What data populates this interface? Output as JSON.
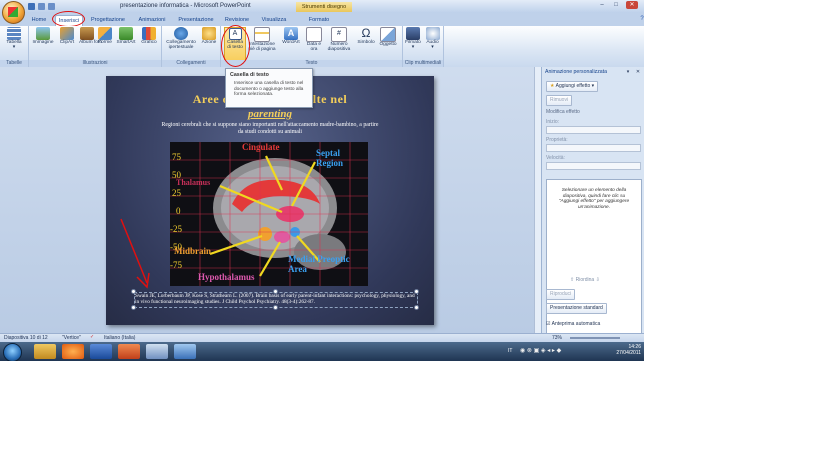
{
  "window": {
    "title": "presentazione informatica - Microsoft PowerPoint",
    "context_tab": "Strumenti disegno",
    "buttons": {
      "min": "–",
      "max": "□",
      "close": "✕"
    }
  },
  "tabs": [
    "Home",
    "Inserisci",
    "Progettazione",
    "Animazioni",
    "Presentazione",
    "Revisione",
    "Visualizza",
    "Formato"
  ],
  "ribbon": {
    "groups": {
      "tabelle": "Tabelle",
      "illustrazioni": "Illustrazioni",
      "collegamenti": "Collegamenti",
      "testo": "Testo",
      "clip": "Clip multimediali"
    },
    "buttons": {
      "tabella": "Tabella",
      "immagine": "Immagine",
      "clipart": "ClipArt",
      "album": "Album foto",
      "forme": "Forme",
      "smartart": "SmartArt",
      "grafico": "Grafico",
      "collegamento": "Collegamento ipertestuale",
      "azione": "Azione",
      "casella": "Casella di testo",
      "intestazione": "Intestazione piè di pagina",
      "wordart": "WordArt",
      "data": "Data e ora",
      "numero": "Numero diapositiva",
      "simbolo": "Simbolo",
      "oggetto": "Oggetto",
      "filmato": "Filmato",
      "audio": "Audio"
    },
    "tooltip": {
      "title": "Casella di testo",
      "desc": "Inserisce una casella di testo nel documento o aggiunge testo alla forma selezionata."
    }
  },
  "slide": {
    "title": "Aree cerebrali coinvolte nel",
    "subtitle": "parenting",
    "body": "Regioni cerebrali che si suppone siano importanti nell'attaccamento madre-bambino, a partire da studi condotti su animali",
    "labels": {
      "cingulate": "Cingulate",
      "thalamus": "Thalamus",
      "septal": "Septal Region",
      "midbrain": "Midbrain",
      "hypothalamus": "Hypothalamus",
      "medial": "Medial Preoptic Area"
    },
    "yticks": [
      "75",
      "50",
      "25",
      "0",
      "-25",
      "-50",
      "-75"
    ],
    "citation": "Swain JE, Lorberbaum JP, Kose S, Strathearn L. (2007). Brain basis of early parent-infant interactions: psychology, physiology, and in vivo functional neuroimaging studies. J Child Psychol Psychiatry. 48(3-4):262-87."
  },
  "pane": {
    "title": "Animazione personalizzata",
    "add_effect": "Aggiungi effetto",
    "remove": "Rimuovi",
    "modify": "Modifica effetto",
    "start_label": "Inizio:",
    "prop_label": "Proprietà:",
    "speed_label": "Velocità:",
    "hint": "Selezionare un elemento della diapositiva, quindi fare clic su \"Aggiungi effetto\" per aggiungere un'animazione.",
    "reorder": "Riordina",
    "play": "Riproduci",
    "slideshow": "Presentazione standard",
    "autopreview": "Anteprima automatica"
  },
  "status": {
    "slide": "Diapositiva 10 di 12",
    "theme": "\"Vertice\"",
    "language": "Italiano (Italia)",
    "zoom": "73%"
  },
  "tray": {
    "lang": "IT",
    "time": "14:26",
    "date": "27/04/2011"
  },
  "colors": {
    "accent": "#15428b",
    "highlight_oval": "#e01010",
    "slide_title": "#f4cf5a"
  }
}
